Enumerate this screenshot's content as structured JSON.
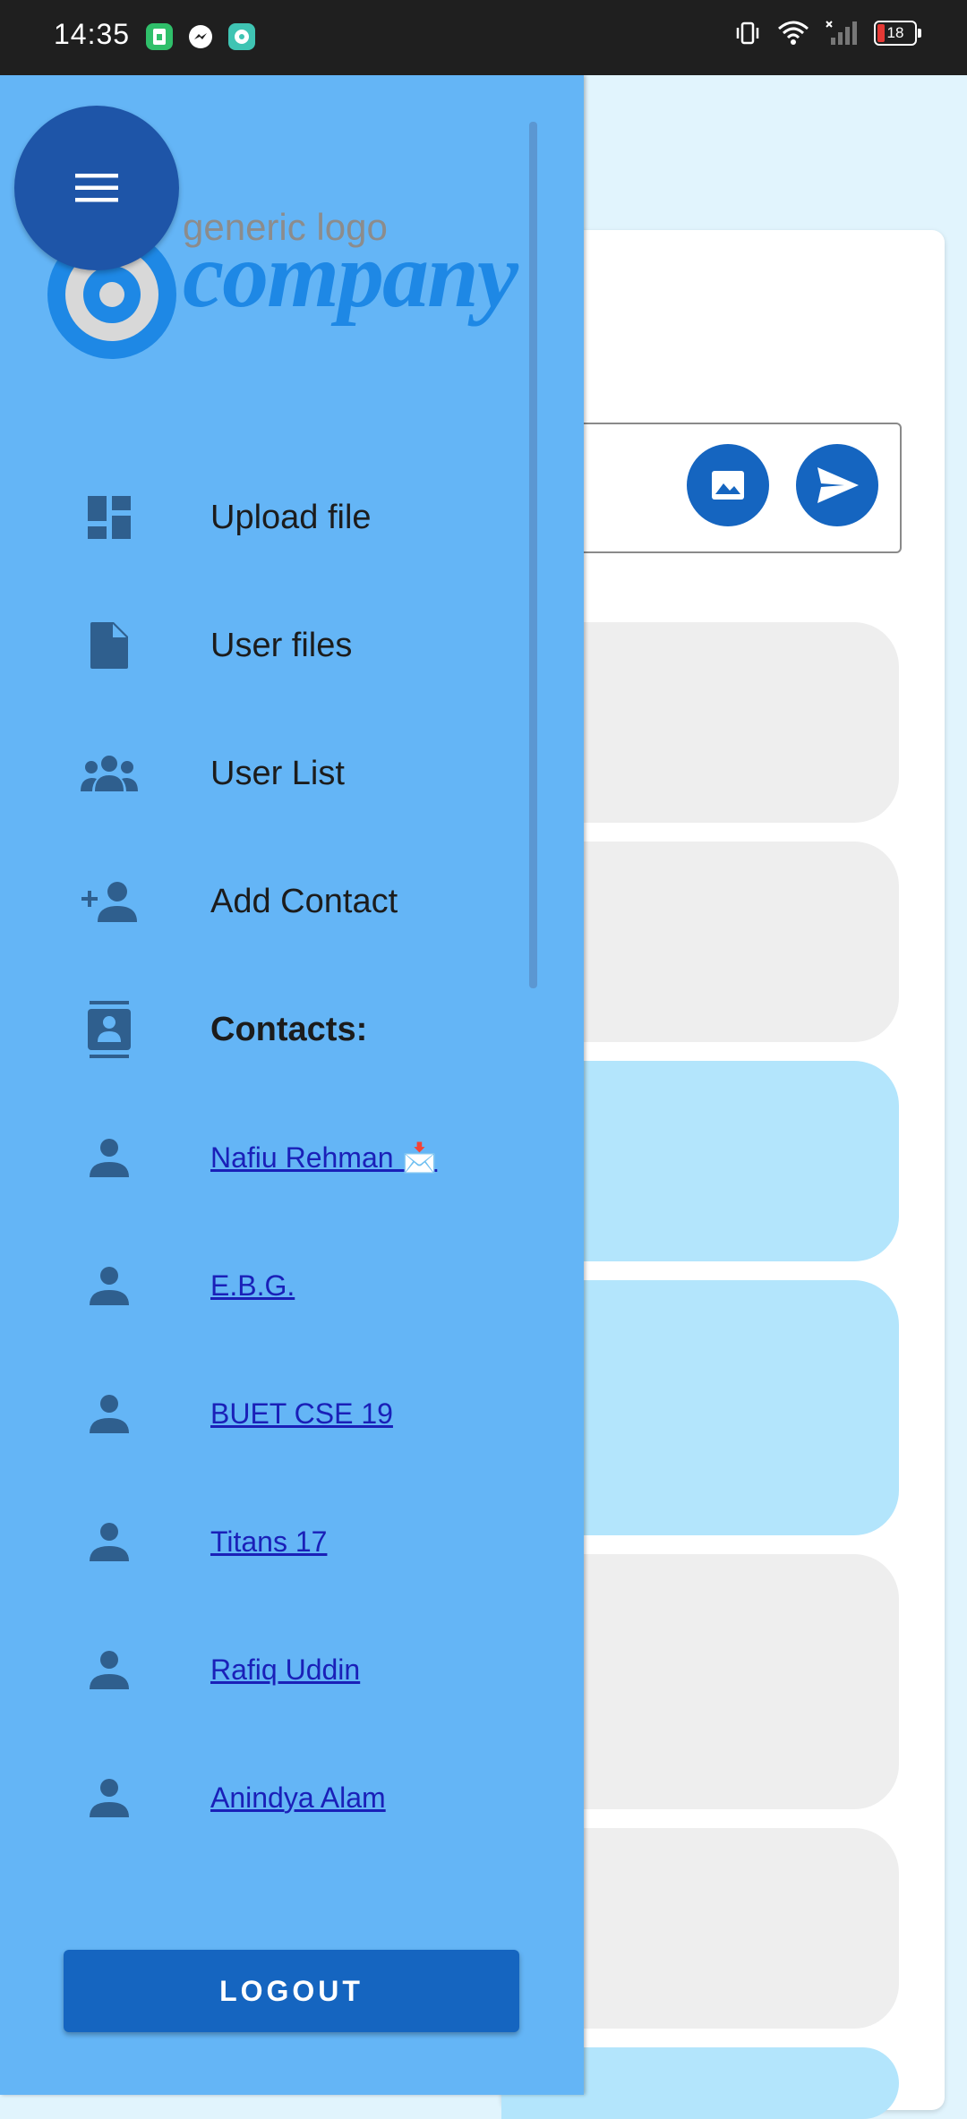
{
  "status_bar": {
    "time": "14:35",
    "battery": "18",
    "app_icons": [
      "sim-app-icon",
      "messenger-icon",
      "chat-app-icon"
    ],
    "right_icons": [
      "vibrate-icon",
      "wifi-icon",
      "no-signal-icon",
      "battery-icon"
    ]
  },
  "drawer": {
    "logo": {
      "tagline": "generic logo",
      "word": "company"
    },
    "menu": [
      {
        "label": "Upload file",
        "icon": "dashboard-icon"
      },
      {
        "label": "User files",
        "icon": "file-icon"
      },
      {
        "label": "User List",
        "icon": "group-icon"
      },
      {
        "label": "Add Contact",
        "icon": "person-add-icon"
      }
    ],
    "contacts_header": {
      "label": "Contacts:",
      "icon": "contacts-icon"
    },
    "contacts": [
      {
        "name": "Nafiu Rehman 📩"
      },
      {
        "name": "E.B.G."
      },
      {
        "name": "BUET CSE 19"
      },
      {
        "name": "Titans 17"
      },
      {
        "name": "Rafiq Uddin"
      },
      {
        "name": "Anindya Alam"
      }
    ],
    "logout_label": "LOGOUT"
  },
  "colors": {
    "drawer_bg": "#64b5f6",
    "accent": "#1565c0",
    "fab": "#1e55a8",
    "link": "#1a20b8",
    "incoming_bubble": "#eeeeee",
    "outgoing_bubble": "#b3e5fc"
  }
}
